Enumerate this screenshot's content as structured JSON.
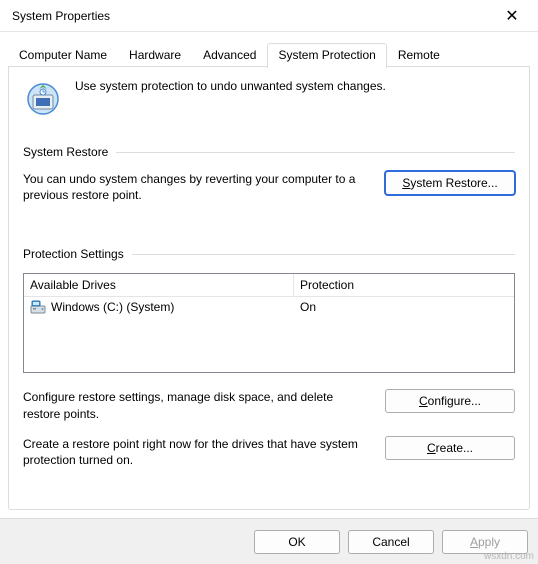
{
  "window": {
    "title": "System Properties",
    "close_glyph": "✕"
  },
  "tabs": {
    "items": [
      {
        "label": "Computer Name"
      },
      {
        "label": "Hardware"
      },
      {
        "label": "Advanced"
      },
      {
        "label": "System Protection"
      },
      {
        "label": "Remote"
      }
    ],
    "active_index": 3
  },
  "intro": {
    "text": "Use system protection to undo unwanted system changes."
  },
  "restore_section": {
    "title": "System Restore",
    "description": "You can undo system changes by reverting your computer to a previous restore point.",
    "button_prefix": "S",
    "button_rest": "ystem Restore..."
  },
  "protection_section": {
    "title": "Protection Settings",
    "columns": {
      "drive": "Available Drives",
      "protection": "Protection"
    },
    "drives": [
      {
        "name": "Windows (C:) (System)",
        "protection": "On"
      }
    ],
    "configure_text": "Configure restore settings, manage disk space, and delete restore points.",
    "configure_prefix": "C",
    "configure_rest": "onfigure...",
    "create_text": "Create a restore point right now for the drives that have system protection turned on.",
    "create_prefix": "C",
    "create_rest": "reate..."
  },
  "footer": {
    "ok": "OK",
    "cancel": "Cancel",
    "apply_prefix": "A",
    "apply_rest": "pply"
  },
  "attribution": "wsxdn.com"
}
